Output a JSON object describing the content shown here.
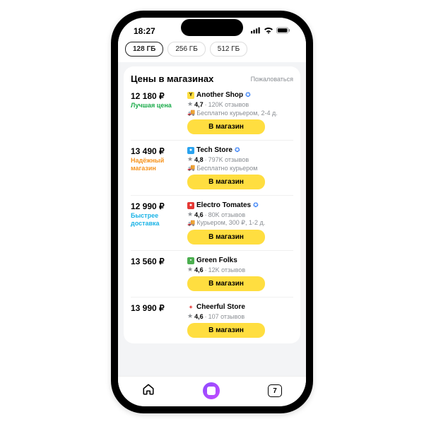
{
  "status": {
    "time": "18:27"
  },
  "chips": [
    "128 ГБ",
    "256 ГБ",
    "512 ГБ"
  ],
  "section": {
    "title": "Цены в магазинах",
    "complain": "Пожаловаться",
    "go_label": "В магазин"
  },
  "offers": [
    {
      "price": "12 180 ₽",
      "badge": "Лучшая цена",
      "badge_class": "green",
      "logo_bg": "#ffde40",
      "logo_fg": "#000",
      "logo_char": "Y",
      "shop": "Another Shop",
      "verified": true,
      "rating": "4,7",
      "reviews": "120K отзывов",
      "delivery": "Бесплатно курьером, 2-4 д."
    },
    {
      "price": "13 490 ₽",
      "badge": "Надёжный магазин",
      "badge_class": "orange",
      "logo_bg": "#2aa3ef",
      "logo_fg": "#fff",
      "logo_char": "●",
      "shop": "Tech Store",
      "verified": true,
      "rating": "4,8",
      "reviews": "797K отзывов",
      "delivery": "Бесплатно курьером"
    },
    {
      "price": "12 990 ₽",
      "badge": "Быстрее доставка",
      "badge_class": "blue",
      "logo_bg": "#e53935",
      "logo_fg": "#fff",
      "logo_char": "●",
      "shop": "Electro Tomates",
      "verified": true,
      "rating": "4,6",
      "reviews": "80K отзывов",
      "delivery": "Курьером, 300 ₽, 1-2 д."
    },
    {
      "price": "13 560 ₽",
      "badge": "",
      "badge_class": "",
      "logo_bg": "#4caf50",
      "logo_fg": "#fff",
      "logo_char": "▪",
      "shop": "Green Folks",
      "verified": false,
      "rating": "4,6",
      "reviews": "12K отзывов",
      "delivery": ""
    },
    {
      "price": "13 990 ₽",
      "badge": "",
      "badge_class": "",
      "logo_bg": "#fff",
      "logo_fg": "#e53935",
      "logo_char": "✦",
      "shop": "Cheerful Store",
      "verified": false,
      "rating": "4,6",
      "reviews": "107 отзывов",
      "delivery": ""
    }
  ],
  "nav": {
    "badge": "7"
  }
}
